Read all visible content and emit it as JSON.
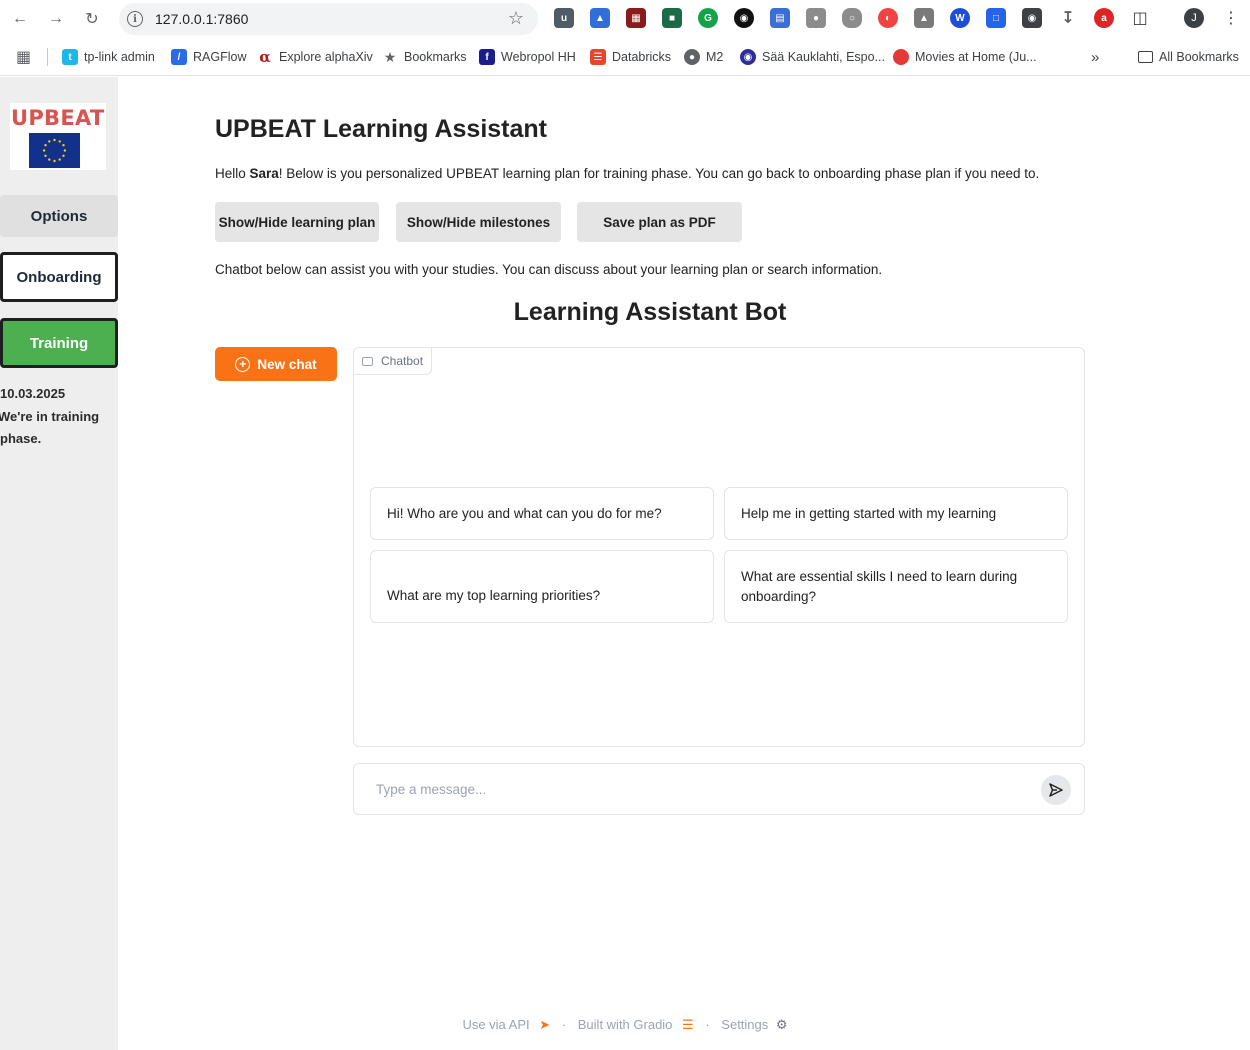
{
  "browser": {
    "url": "127.0.0.1:7860",
    "bookmarks": [
      {
        "label": "tp-link admin",
        "color": "#1fb7e9",
        "icon": "tp-link-icon"
      },
      {
        "label": "RAGFlow",
        "color": "#2a6ce6",
        "icon": "ragflow-icon"
      },
      {
        "label": "Explore alphaXiv",
        "color": "#b31b1b",
        "icon": "alphaxiv-icon"
      },
      {
        "label": "Bookmarks",
        "color": "#5f6368",
        "icon": "star-icon"
      },
      {
        "label": "Webropol HH",
        "color": "#1c1c8c",
        "icon": "webropol-icon"
      },
      {
        "label": "Databricks",
        "color": "#e8452c",
        "icon": "databricks-icon"
      },
      {
        "label": "M2",
        "color": "#5f6368",
        "icon": "globe-icon"
      },
      {
        "label": "Sää Kauklahti, Espo...",
        "color": "#2d2d9c",
        "icon": "weather-icon"
      },
      {
        "label": "Movies at Home (Ju...",
        "color": "#e53935",
        "icon": "tomato-icon"
      }
    ],
    "all_bookmarks": "All Bookmarks",
    "avatar_initial": "J"
  },
  "sidebar": {
    "logo_text": "UPBEAT",
    "options": "Options",
    "onboarding": "Onboarding",
    "training": "Training",
    "date": "10.03.2025",
    "status_line1": "We're in training",
    "status_line2": "phase."
  },
  "main": {
    "title": "UPBEAT Learning Assistant",
    "hello_prefix": "Hello ",
    "user_name": "Sara",
    "hello_suffix": "! Below is you personalized UPBEAT learning plan for training phase. You can go back to onboarding phase plan if you need to.",
    "buttons": {
      "learning_plan": "Show/Hide learning plan",
      "milestones": "Show/Hide milestones",
      "save_pdf": "Save plan as PDF"
    },
    "chat_intro": "Chatbot below can assist you with your studies. You can discuss about your learning plan or search information.",
    "bot_title": "Learning Assistant Bot",
    "new_chat": "New chat",
    "chatbot_label": "Chatbot",
    "examples": [
      "Hi! Who are you and what can you do for me?",
      "Help me in getting started with my learning",
      "What are my top learning priorities?",
      "What are essential skills I need to learn during onboarding?"
    ],
    "input_placeholder": "Type a message..."
  },
  "footer": {
    "api": "Use via API",
    "built": "Built with Gradio",
    "settings": "Settings"
  },
  "colors": {
    "accent_orange": "#f97316",
    "training_green": "#4caf50",
    "logo_red": "#d9534f",
    "eu_blue": "#12318a"
  }
}
